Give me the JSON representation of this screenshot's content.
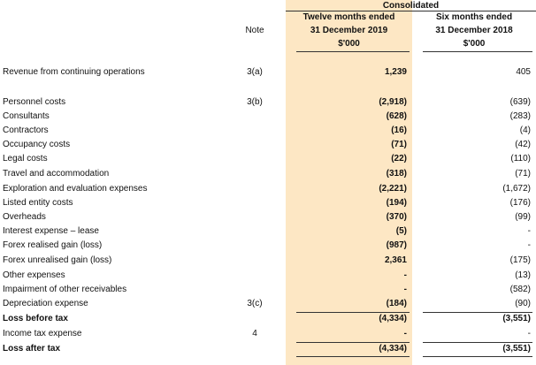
{
  "header": {
    "consolidated": "Consolidated",
    "note": "Note",
    "col1": {
      "line1": "Twelve months ended",
      "line2": "31 December 2019",
      "unit": "$'000"
    },
    "col2": {
      "line1": "Six months ended",
      "line2": "31 December 2018",
      "unit": "$'000"
    }
  },
  "rows": [
    {
      "label": "Revenue from continuing operations",
      "note": "3(a)",
      "v2019": "1,239",
      "v2018": "405",
      "bold": false
    },
    {
      "label": "Personnel costs",
      "note": "3(b)",
      "v2019": "(2,918)",
      "v2018": "(639)",
      "bold": false
    },
    {
      "label": "Consultants",
      "note": "",
      "v2019": "(628)",
      "v2018": "(283)",
      "bold": false
    },
    {
      "label": "Contractors",
      "note": "",
      "v2019": "(16)",
      "v2018": "(4)",
      "bold": false
    },
    {
      "label": "Occupancy costs",
      "note": "",
      "v2019": "(71)",
      "v2018": "(42)",
      "bold": false
    },
    {
      "label": "Legal costs",
      "note": "",
      "v2019": "(22)",
      "v2018": "(110)",
      "bold": false
    },
    {
      "label": "Travel and accommodation",
      "note": "",
      "v2019": "(318)",
      "v2018": "(71)",
      "bold": false
    },
    {
      "label": "Exploration and evaluation expenses",
      "note": "",
      "v2019": "(2,221)",
      "v2018": "(1,672)",
      "bold": false
    },
    {
      "label": "Listed entity costs",
      "note": "",
      "v2019": "(194)",
      "v2018": "(176)",
      "bold": false
    },
    {
      "label": "Overheads",
      "note": "",
      "v2019": "(370)",
      "v2018": "(99)",
      "bold": false
    },
    {
      "label": "Interest expense – lease",
      "note": "",
      "v2019": "(5)",
      "v2018": "-",
      "bold": false
    },
    {
      "label": "Forex realised gain (loss)",
      "note": "",
      "v2019": "(987)",
      "v2018": "-",
      "bold": false
    },
    {
      "label": "Forex unrealised gain (loss)",
      "note": "",
      "v2019": "2,361",
      "v2018": "(175)",
      "bold": false
    },
    {
      "label": "Other expenses",
      "note": "",
      "v2019": "-",
      "v2018": "(13)",
      "bold": false
    },
    {
      "label": "Impairment of other receivables",
      "note": "",
      "v2019": "-",
      "v2018": "(582)",
      "bold": false
    },
    {
      "label": "Depreciation expense",
      "note": "3(c)",
      "v2019": "(184)",
      "v2018": "(90)",
      "bold": false
    },
    {
      "label": "Loss before tax",
      "note": "",
      "v2019": "(4,334)",
      "v2018": "(3,551)",
      "bold": true
    },
    {
      "label": "Income tax expense",
      "note": "4",
      "v2019": "-",
      "v2018": "-",
      "bold": false
    },
    {
      "label": "Loss after tax",
      "note": "",
      "v2019": "(4,334)",
      "v2018": "(3,551)",
      "bold": true
    }
  ]
}
